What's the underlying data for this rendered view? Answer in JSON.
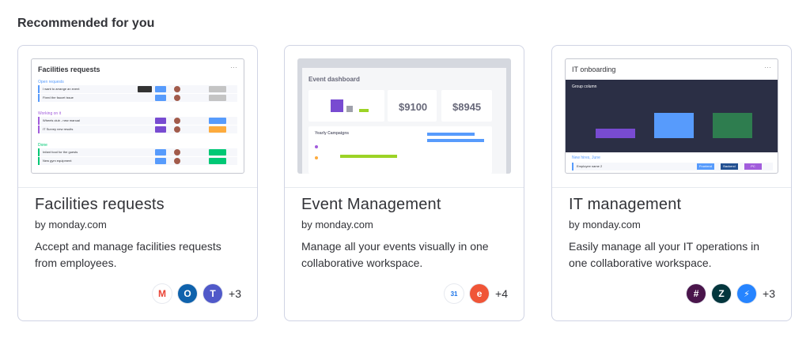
{
  "section": {
    "title": "Recommended for you"
  },
  "cards": [
    {
      "title": "Facilities requests",
      "author": "by monday.com",
      "description": "Accept and manage facilities requests from employees.",
      "more": "+3",
      "thumb": {
        "header": "Facilities requests",
        "groups": [
          "Open requests",
          "Working on it",
          "Done"
        ],
        "rows": [
          "I want to arrange an event",
          "Fixed the faucet issue",
          "Wheels club - new manual",
          "IT Survey new results",
          "Infant food for the guests",
          "New gym equipment"
        ]
      },
      "icons": [
        {
          "name": "gmail",
          "glyph": "M",
          "color": "#ea4335",
          "bg": "#ffffff"
        },
        {
          "name": "outlook",
          "glyph": "O",
          "color": "#ffffff",
          "bg": "#0f62ac"
        },
        {
          "name": "teams",
          "glyph": "T",
          "color": "#ffffff",
          "bg": "#5059c9"
        }
      ]
    },
    {
      "title": "Event Management",
      "author": "by monday.com",
      "description": "Manage all your events visually in one collaborative workspace.",
      "more": "+4",
      "thumb": {
        "header": "Event dashboard",
        "num1": "$9100",
        "num2": "$8945",
        "sub": "Yearly Campaigns"
      },
      "icons": [
        {
          "name": "google-calendar",
          "glyph": "31",
          "color": "#1a73e8",
          "bg": "#ffffff"
        },
        {
          "name": "eventbrite",
          "glyph": "e",
          "color": "#ffffff",
          "bg": "#f05537"
        }
      ]
    },
    {
      "title": "IT management",
      "author": "by monday.com",
      "description": "Easily manage all your IT operations in one collaborative workspace.",
      "more": "+3",
      "thumb": {
        "header": "IT onboarding",
        "chart_title": "Group column",
        "group": "New hires, June",
        "row": "Employee name 2",
        "labels": [
          "Frontend",
          "Backend",
          "PC"
        ]
      },
      "icons": [
        {
          "name": "slack",
          "glyph": "#",
          "color": "#ffffff",
          "bg": "#4a154b"
        },
        {
          "name": "zendesk",
          "glyph": "Z",
          "color": "#ffffff",
          "bg": "#03363d"
        },
        {
          "name": "jira-service",
          "glyph": "⚡",
          "color": "#ffffff",
          "bg": "#2684ff"
        }
      ]
    }
  ]
}
